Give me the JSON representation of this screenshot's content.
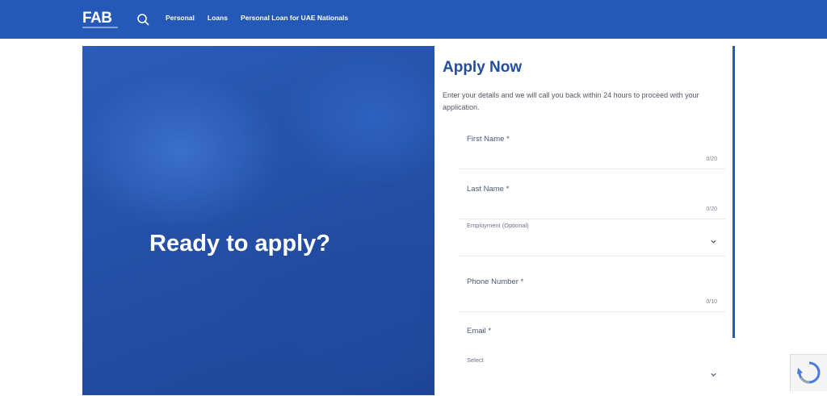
{
  "header": {
    "logo": "FAB",
    "nav": [
      "Personal",
      "Loans",
      "Personal Loan for UAE Nationals"
    ]
  },
  "hero": {
    "title": "Ready to apply?"
  },
  "form": {
    "title": "Apply Now",
    "subtitle": "Enter your details and we will call you back within 24 hours to proceed with your application.",
    "fields": [
      {
        "label": "First Name *",
        "count": "0/20"
      },
      {
        "label": "Last Name *",
        "count": "0/20"
      },
      {
        "label": "Employment (Optional)"
      },
      {
        "label": "Phone Number *",
        "count": "0/10"
      },
      {
        "label": "Email *"
      },
      {
        "label": "Select"
      }
    ]
  },
  "colors": {
    "brand_blue": "#2559b8",
    "title_blue": "#244d9c"
  }
}
